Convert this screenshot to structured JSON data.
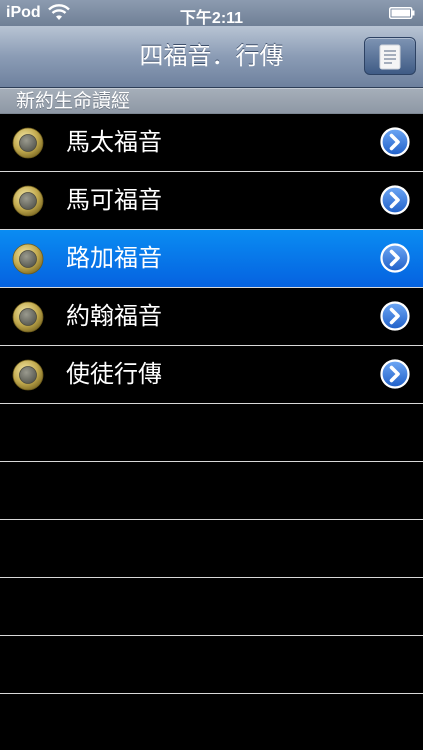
{
  "status_bar": {
    "carrier": "iPod",
    "time": "下午2:11"
  },
  "nav": {
    "title": "四福音．行傳"
  },
  "section": {
    "header": "新約生命讀經"
  },
  "list": {
    "items": [
      {
        "label": "馬太福音",
        "selected": false
      },
      {
        "label": "馬可福音",
        "selected": false
      },
      {
        "label": "路加福音",
        "selected": true
      },
      {
        "label": "約翰福音",
        "selected": false
      },
      {
        "label": "使徒行傳",
        "selected": false
      }
    ]
  },
  "colors": {
    "selected_row": "#0a74ea",
    "bullet_gold": "#c9b35a",
    "disclosure_blue": "#2a6fd6"
  }
}
